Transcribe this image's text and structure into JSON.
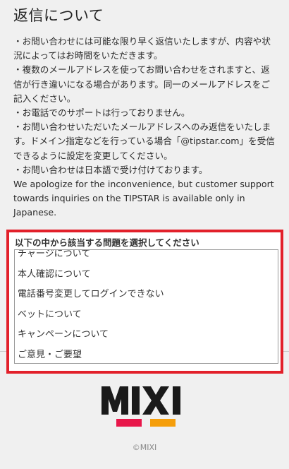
{
  "page": {
    "title": "返信について",
    "paragraphs": [
      "・お問い合わせには可能な限り早く返信いたしますが、内容や状況によってはお時間をいただきます。",
      "・複数のメールアドレスを使ってお問い合わせをされますと、返信が行き違いになる場合があります。同一のメールアドレスをご記入ください。",
      "・お電話でのサポートは行っておりません。",
      "・お問い合わせいただいたメールアドレスへのみ返信をいたします。ドメイン指定などを行っている場合「@tipstar.com」を受信できるように設定を変更してください。",
      "・お問い合わせは日本語で受け付けております。",
      "We apologize for the inconvenience, but customer support towards inquiries on the TIPSTAR is available only in Japanese."
    ]
  },
  "selector": {
    "title": "以下の中から該当する問題を選択してください",
    "options": [
      "チャージについて",
      "本人確認について",
      "電話番号変更してログインできない",
      "ベットについて",
      "キャンペーンについて",
      "ご意見・ご要望"
    ]
  },
  "footer": {
    "logo_text": "MIXI",
    "logo_colors": [
      "#e8174a",
      "#f59e0b"
    ],
    "copyright": "©MIXI"
  },
  "colors": {
    "highlight_border": "#e2202a"
  }
}
